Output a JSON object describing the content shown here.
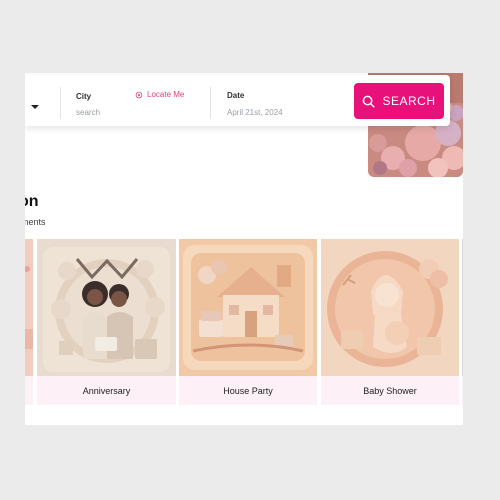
{
  "search": {
    "city_label": "City",
    "city_placeholder": "search",
    "locate_label": "Locate Me",
    "date_label": "Date",
    "date_value": "April 21st, 2024",
    "button_label": "SEARCH"
  },
  "section": {
    "title": "on",
    "subtitle": "ments"
  },
  "cards": [
    {
      "label": ""
    },
    {
      "label": "Anniversary"
    },
    {
      "label": "House Party"
    },
    {
      "label": "Baby Shower"
    },
    {
      "label": ""
    }
  ],
  "colors": {
    "accent": "#e8117a",
    "card_label_bg": "#fdf0f7"
  }
}
